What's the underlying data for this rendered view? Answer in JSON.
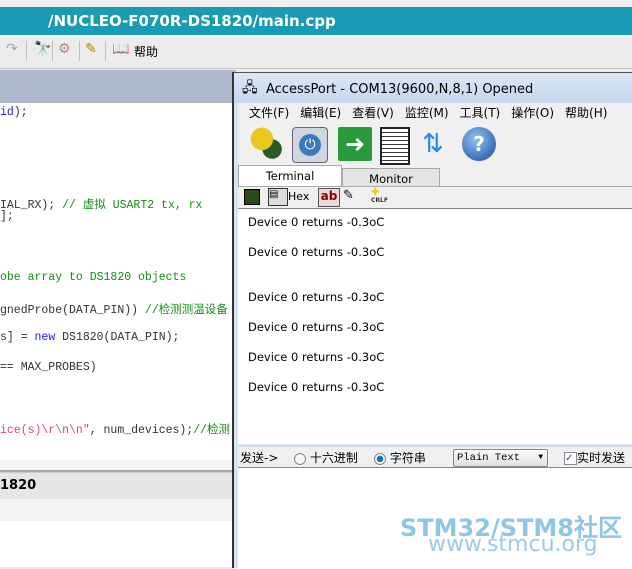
{
  "editor": {
    "title": "/NUCLEO-F070R-DS1820/main.cpp",
    "toolbar": {
      "help_label": "帮助"
    },
    "code_lines": [
      {
        "segments": [
          {
            "t": "id",
            "c": "b"
          },
          {
            "t": ");",
            "c": ""
          }
        ]
      },
      {
        "segments": [
          {
            "t": "IAL_RX); ",
            "c": ""
          },
          {
            "t": "// 虚拟 USART2 tx, rx",
            "c": "g"
          }
        ]
      },
      {
        "segments": [
          {
            "t": "];",
            "c": ""
          }
        ]
      },
      {
        "segments": [
          {
            "t": "obe array to DS1820 objects",
            "c": "g"
          }
        ]
      },
      {
        "segments": [
          {
            "t": "gnedProbe(DATA_PIN)) ",
            "c": ""
          },
          {
            "t": "//检测测温设备",
            "c": "g"
          }
        ]
      },
      {
        "segments": [
          {
            "t": "s] = ",
            "c": ""
          },
          {
            "t": "new",
            "c": "b"
          },
          {
            "t": " DS1820(DATA_PIN);",
            "c": ""
          }
        ]
      },
      {
        "segments": [
          {
            "t": "== MAX_PROBES)",
            "c": ""
          }
        ]
      },
      {
        "segments": [
          {
            "t": "ice(s)\\r\\n\\n\"",
            "c": "p"
          },
          {
            "t": ", num_devices);",
            "c": ""
          },
          {
            "t": "//检测",
            "c": "g"
          }
        ]
      }
    ],
    "panel_title": "1820"
  },
  "accessport": {
    "title": "AccessPort - COM13(9600,N,8,1) Opened",
    "menu": [
      "文件(F)",
      "编辑(E)",
      "查看(V)",
      "监控(M)",
      "工具(T)",
      "操作(O)",
      "帮助(H)"
    ],
    "tabs": [
      {
        "label": "Terminal",
        "active": true
      },
      {
        "label": "Monitor",
        "active": false
      }
    ],
    "small_toolbar": {
      "hex_label": "Hex",
      "ab_label": "ab",
      "crlf_label": "CRLF"
    },
    "terminal_lines": [
      "Device 0 returns -0.3oC",
      "Device 0 returns -0.3oC",
      "Device 0 returns -0.3oC",
      "Device 0 returns -0.3oC",
      "Device 0 returns -0.3oC",
      "Device 0 returns -0.3oC"
    ],
    "send": {
      "label": "发送->",
      "hex_option": "十六进制",
      "string_option": "字符串",
      "selected": "string",
      "format": "Plain Text",
      "realtime_label": "实时发送",
      "realtime_checked": true
    }
  },
  "watermark": {
    "line1": "STM32/STM8社区",
    "line2": "www.stmcu.org"
  }
}
